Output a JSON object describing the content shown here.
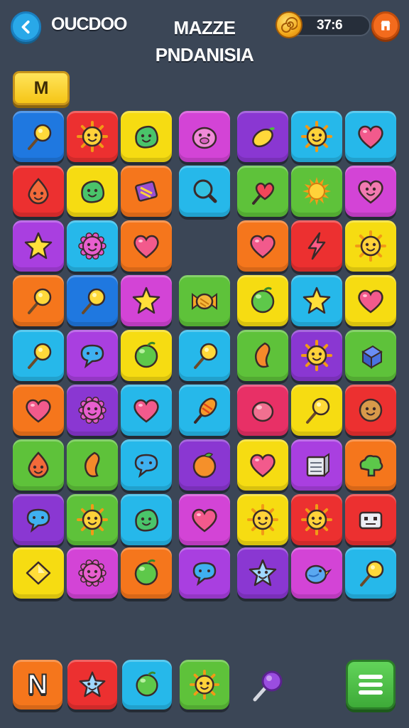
{
  "header": {
    "back_icon": "chevron-left-icon",
    "brand": "OUCDOO",
    "title_line1": "MAZZE",
    "title_line2": "PNDANISIA",
    "coin_icon": "spiral-coin-icon",
    "coins": "37:6",
    "shop_icon": "shop-icon"
  },
  "level": {
    "label": "M"
  },
  "colors": {
    "background": "#3b4656",
    "blue": "#1f78e0",
    "red": "#ec3030",
    "yellow": "#f6dc12",
    "purple": "#a93fe0",
    "violet": "#8a37d2",
    "cyan": "#26b8ea",
    "orange": "#f5761c",
    "green": "#5ec23a",
    "magenta": "#d344d6",
    "pink": "#e83066"
  },
  "board": {
    "rows": [
      [
        {
          "color": "blue",
          "icon": "lollipop-icon"
        },
        {
          "color": "red",
          "icon": "sun-face-icon"
        },
        {
          "color": "yellow",
          "icon": "blob-face-icon"
        },
        {
          "color": "magenta",
          "icon": "pig-face-icon"
        },
        {
          "color": "violet",
          "icon": "lemon-icon"
        },
        {
          "color": "cyan",
          "icon": "sun-face-icon"
        },
        {
          "color": "cyan",
          "icon": "heart-icon"
        }
      ],
      [
        {
          "color": "red",
          "icon": "drop-face-icon"
        },
        {
          "color": "yellow",
          "icon": "blob-face-icon"
        },
        {
          "color": "orange",
          "icon": "candy-box-icon"
        },
        {
          "color": "cyan",
          "icon": "magnifier-icon"
        },
        {
          "color": "green",
          "icon": "heart-lollipop-icon"
        },
        {
          "color": "green",
          "icon": "sun-icon"
        },
        {
          "color": "magenta",
          "icon": "heart-face-icon"
        }
      ],
      [
        {
          "color": "purple",
          "icon": "star-icon"
        },
        {
          "color": "cyan",
          "icon": "spiky-face-icon"
        },
        {
          "color": "orange",
          "icon": "heart-icon"
        },
        {
          "color": "empty",
          "icon": ""
        },
        {
          "color": "orange",
          "icon": "heart-icon"
        },
        {
          "color": "red",
          "icon": "bolt-icon"
        },
        {
          "color": "yellow",
          "icon": "sun-face-icon"
        }
      ],
      [
        {
          "color": "orange",
          "icon": "lollipop-icon"
        },
        {
          "color": "blue",
          "icon": "lollipop-icon"
        },
        {
          "color": "magenta",
          "icon": "star-icon"
        },
        {
          "color": "green",
          "icon": "wrapped-candy-icon"
        },
        {
          "color": "yellow",
          "icon": "round-candy-icon"
        },
        {
          "color": "cyan",
          "icon": "star-icon"
        },
        {
          "color": "yellow",
          "icon": "heart-icon"
        }
      ],
      [
        {
          "color": "cyan",
          "icon": "lollipop-icon"
        },
        {
          "color": "purple",
          "icon": "speech-bubble-icon"
        },
        {
          "color": "yellow",
          "icon": "round-candy-icon"
        },
        {
          "color": "cyan",
          "icon": "lollipop-icon"
        },
        {
          "color": "green",
          "icon": "bean-icon"
        },
        {
          "color": "violet",
          "icon": "sun-face-icon"
        },
        {
          "color": "green",
          "icon": "cube-icon"
        }
      ],
      [
        {
          "color": "orange",
          "icon": "heart-icon"
        },
        {
          "color": "violet",
          "icon": "spiky-face-icon"
        },
        {
          "color": "cyan",
          "icon": "heart-icon"
        },
        {
          "color": "cyan",
          "icon": "popsicle-icon"
        },
        {
          "color": "pink",
          "icon": "plum-icon"
        },
        {
          "color": "yellow",
          "icon": "lollipop-icon"
        },
        {
          "color": "red",
          "icon": "cookie-face-icon"
        }
      ],
      [
        {
          "color": "green",
          "icon": "drop-face-icon"
        },
        {
          "color": "green",
          "icon": "bean-icon"
        },
        {
          "color": "cyan",
          "icon": "speech-bubble-icon"
        },
        {
          "color": "violet",
          "icon": "peach-icon"
        },
        {
          "color": "yellow",
          "icon": "heart-icon"
        },
        {
          "color": "purple",
          "icon": "box-icon"
        },
        {
          "color": "orange",
          "icon": "cloud-icon"
        }
      ],
      [
        {
          "color": "violet",
          "icon": "speech-bubble-icon"
        },
        {
          "color": "green",
          "icon": "sun-face-icon"
        },
        {
          "color": "cyan",
          "icon": "blob-face-icon"
        },
        {
          "color": "magenta",
          "icon": "heart-icon"
        },
        {
          "color": "yellow",
          "icon": "sun-face-icon"
        },
        {
          "color": "red",
          "icon": "sun-face-icon"
        },
        {
          "color": "red",
          "icon": "robot-face-icon"
        }
      ],
      [
        {
          "color": "yellow",
          "icon": "diamond-icon"
        },
        {
          "color": "magenta",
          "icon": "spiky-face-icon"
        },
        {
          "color": "orange",
          "icon": "round-candy-icon"
        },
        {
          "color": "purple",
          "icon": "speech-bubble-icon"
        },
        {
          "color": "violet",
          "icon": "star-face-icon"
        },
        {
          "color": "magenta",
          "icon": "bird-icon"
        },
        {
          "color": "cyan",
          "icon": "lollipop-icon"
        }
      ]
    ]
  },
  "tray": {
    "items": [
      {
        "kind": "letter",
        "text": "N",
        "color": "orange"
      },
      {
        "kind": "icon",
        "icon": "star-face-icon",
        "color": "red"
      },
      {
        "kind": "icon",
        "icon": "round-candy-icon",
        "color": "cyan"
      },
      {
        "kind": "icon",
        "icon": "sun-face-icon",
        "color": "green"
      }
    ],
    "loose_icon": "lollipop-icon",
    "menu_icon": "menu-icon"
  }
}
